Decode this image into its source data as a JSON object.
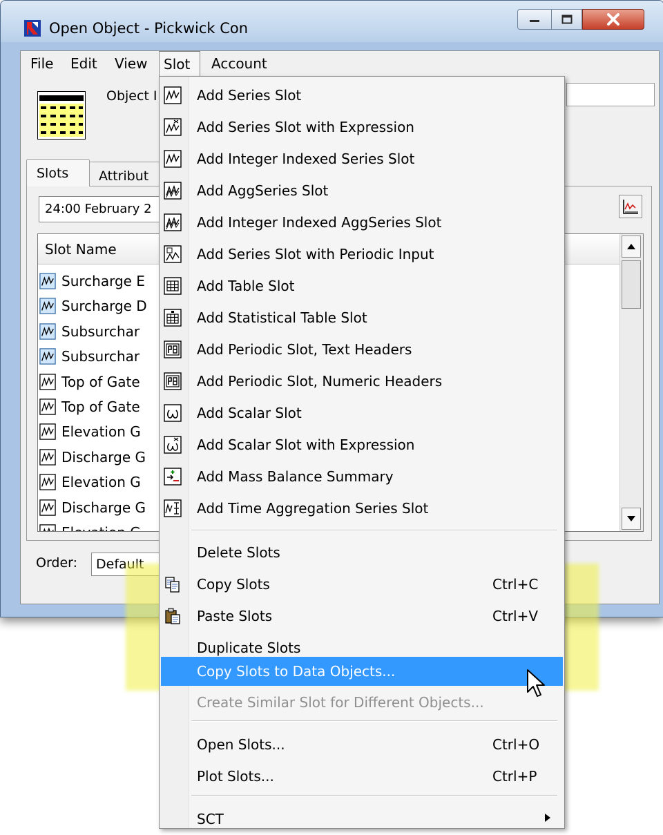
{
  "window": {
    "title": "Open Object - Pickwick Con"
  },
  "menubar": [
    {
      "label": "File"
    },
    {
      "label": "Edit"
    },
    {
      "label": "View"
    },
    {
      "label": "Slot"
    },
    {
      "label": "Account"
    }
  ],
  "object": {
    "name_label": "Object I"
  },
  "tabs": [
    {
      "label": "Slots"
    },
    {
      "label": "Attribut"
    }
  ],
  "date_field": "24:00 February 2",
  "slot_list": {
    "header": "Slot Name",
    "rows": [
      {
        "name": "Surcharge E",
        "icon": "series-slot-icon",
        "selected": true
      },
      {
        "name": "Surcharge D",
        "icon": "series-slot-icon",
        "selected": true
      },
      {
        "name": "Subsurchar",
        "icon": "series-slot-icon",
        "selected": true
      },
      {
        "name": "Subsurchar",
        "icon": "series-slot-icon",
        "selected": true
      },
      {
        "name": "Top of Gate",
        "icon": "series-slot-icon",
        "selected": false
      },
      {
        "name": "Top of Gate",
        "icon": "series-slot-icon",
        "selected": false
      },
      {
        "name": "Elevation G",
        "icon": "series-slot-icon",
        "selected": false
      },
      {
        "name": "Discharge G",
        "icon": "series-slot-icon",
        "selected": false
      },
      {
        "name": "Elevation G",
        "icon": "series-slot-icon",
        "selected": false
      },
      {
        "name": "Discharge G",
        "icon": "series-slot-icon",
        "selected": false
      },
      {
        "name": "Elevation G",
        "icon": "series-slot-icon",
        "selected": false
      }
    ]
  },
  "order": {
    "label": "Order:",
    "value": "Default"
  },
  "slot_menu": {
    "items": [
      {
        "label": "Add Series Slot",
        "icon": "series-slot-icon",
        "shortcut": "",
        "state": "normal"
      },
      {
        "label": "Add Series Slot with Expression",
        "icon": "series-expression-icon",
        "shortcut": "",
        "state": "normal"
      },
      {
        "label": "Add Integer Indexed Series Slot",
        "icon": "integer-series-icon",
        "shortcut": "",
        "state": "normal"
      },
      {
        "label": "Add AggSeries Slot",
        "icon": "agg-series-icon",
        "shortcut": "",
        "state": "normal"
      },
      {
        "label": "Add Integer Indexed AggSeries Slot",
        "icon": "integer-agg-series-icon",
        "shortcut": "",
        "state": "normal"
      },
      {
        "label": "Add Series Slot with Periodic Input",
        "icon": "periodic-input-icon",
        "shortcut": "",
        "state": "normal"
      },
      {
        "label": "Add Table Slot",
        "icon": "table-slot-icon",
        "shortcut": "",
        "state": "normal"
      },
      {
        "label": "Add Statistical Table Slot",
        "icon": "statistical-table-icon",
        "shortcut": "",
        "state": "normal"
      },
      {
        "label": "Add Periodic Slot, Text Headers",
        "icon": "periodic-slot-icon",
        "shortcut": "",
        "state": "normal"
      },
      {
        "label": "Add Periodic Slot, Numeric Headers",
        "icon": "periodic-slot-icon",
        "shortcut": "",
        "state": "normal"
      },
      {
        "label": "Add Scalar Slot",
        "icon": "scalar-slot-icon",
        "shortcut": "",
        "state": "normal"
      },
      {
        "label": "Add Scalar Slot with Expression",
        "icon": "scalar-expression-icon",
        "shortcut": "",
        "state": "normal"
      },
      {
        "label": "Add Mass Balance Summary",
        "icon": "mass-balance-icon",
        "shortcut": "",
        "state": "normal"
      },
      {
        "label": "Add Time Aggregation Series Slot",
        "icon": "time-aggregation-icon",
        "shortcut": "",
        "state": "normal"
      },
      {
        "label": "Delete Slots",
        "icon": "",
        "shortcut": "",
        "state": "normal"
      },
      {
        "label": "Copy Slots",
        "icon": "copy-icon",
        "shortcut": "Ctrl+C",
        "state": "normal"
      },
      {
        "label": "Paste Slots",
        "icon": "paste-icon",
        "shortcut": "Ctrl+V",
        "state": "normal"
      },
      {
        "label": "Duplicate Slots",
        "icon": "",
        "shortcut": "",
        "state": "normal"
      },
      {
        "label": "Copy Slots to Data Objects...",
        "icon": "",
        "shortcut": "",
        "state": "active"
      },
      {
        "label": "Create Similar Slot for Different Objects...",
        "icon": "",
        "shortcut": "",
        "state": "disabled"
      },
      {
        "label": "Open Slots...",
        "icon": "",
        "shortcut": "Ctrl+O",
        "state": "normal"
      },
      {
        "label": "Plot Slots...",
        "icon": "",
        "shortcut": "Ctrl+P",
        "state": "normal"
      },
      {
        "label": "SCT",
        "icon": "",
        "shortcut": "",
        "state": "submenu"
      }
    ]
  },
  "colors": {
    "menu_highlight": "#3399ff",
    "callout_yellow": "#f0f046",
    "selected_row_icon_bg": "#cfe6fb"
  }
}
